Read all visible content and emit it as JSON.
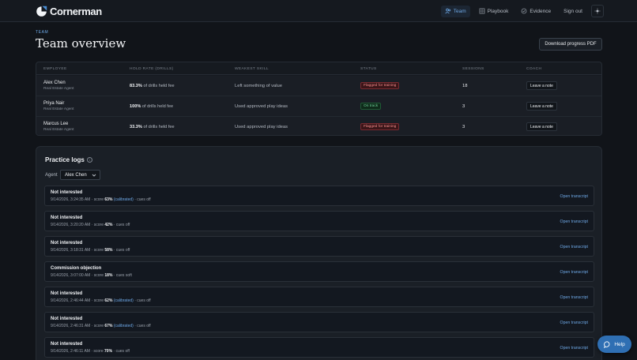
{
  "app": {
    "name": "Cornerman"
  },
  "nav": {
    "items": [
      {
        "label": "Team",
        "icon": "team-icon",
        "active": true
      },
      {
        "label": "Playbook",
        "icon": "book-icon",
        "active": false
      },
      {
        "label": "Evidence",
        "icon": "check-circle-icon",
        "active": false
      },
      {
        "label": "Sign out",
        "icon": "",
        "active": false
      }
    ],
    "theme_icon": "sun-icon"
  },
  "header": {
    "eyebrow": "TEAM",
    "title": "Team overview",
    "download_label": "Download progress PDF"
  },
  "team_table": {
    "columns": [
      "EMPLOYEE",
      "HOLD RATE (DRILLS)",
      "WEAKEST SKILL",
      "STATUS",
      "SESSIONS",
      "COACH"
    ],
    "rows": [
      {
        "name": "Alex Chen",
        "role": "Real Estate Agent",
        "hold_pct": "83.3%",
        "hold_suffix": "of drills held fee",
        "weakest": "Left something of value",
        "status": "Flagged for training",
        "status_type": "red",
        "sessions": "18",
        "coach": "Leave a note"
      },
      {
        "name": "Priya Nair",
        "role": "Real Estate Agent",
        "hold_pct": "100%",
        "hold_suffix": "of drills held fee",
        "weakest": "Used approved play ideas",
        "status": "On track",
        "status_type": "green",
        "sessions": "3",
        "coach": "Leave a note"
      },
      {
        "name": "Marcus Lee",
        "role": "Real Estate Agent",
        "hold_pct": "33.3%",
        "hold_suffix": "of drills held fee",
        "weakest": "Used approved play ideas",
        "status": "Flagged for training",
        "status_type": "red",
        "sessions": "3",
        "coach": "Leave a note"
      }
    ]
  },
  "practice_logs": {
    "title": "Practice logs",
    "agent_label": "Agent",
    "agent_selected": "Alex Chen",
    "open_label": "Open transcript",
    "items": [
      {
        "title": "Not interested",
        "timestamp": "9/14/2026, 3:24:35 AM",
        "score": "63%",
        "calibrated": true,
        "cues": "cues off"
      },
      {
        "title": "Not interested",
        "timestamp": "9/14/2026, 3:20:20 AM",
        "score": "42%",
        "calibrated": false,
        "cues": "cues off"
      },
      {
        "title": "Not interested",
        "timestamp": "9/14/2026, 3:18:31 AM",
        "score": "58%",
        "calibrated": false,
        "cues": "cues off"
      },
      {
        "title": "Commission objection",
        "timestamp": "9/14/2026, 3:07:00 AM",
        "score": "18%",
        "calibrated": false,
        "cues": "cues soft"
      },
      {
        "title": "Not interested",
        "timestamp": "9/14/2026, 2:46:44 AM",
        "score": "62%",
        "calibrated": true,
        "cues": "cues off"
      },
      {
        "title": "Not interested",
        "timestamp": "9/14/2026, 2:46:31 AM",
        "score": "67%",
        "calibrated": true,
        "cues": "cues off"
      },
      {
        "title": "Not interested",
        "timestamp": "9/14/2026, 2:46:11 AM",
        "score": "70%",
        "calibrated": false,
        "cues": "cues off"
      }
    ],
    "calibrated_label": "(calibrated)",
    "score_prefix": "score"
  },
  "help": {
    "label": "Help"
  }
}
